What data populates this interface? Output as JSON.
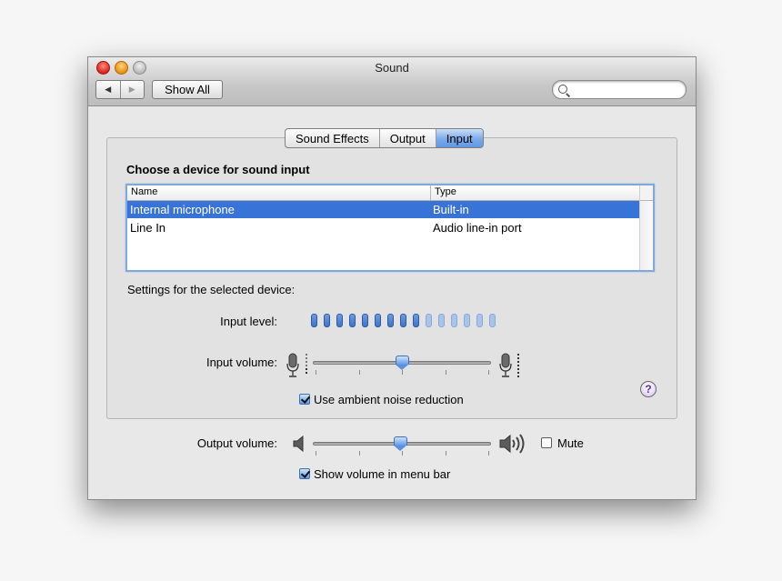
{
  "window": {
    "title": "Sound",
    "nav_back": "◀",
    "nav_forward": "▶",
    "show_all": "Show All",
    "search_placeholder": ""
  },
  "tabs": [
    {
      "label": "Sound Effects",
      "active": false
    },
    {
      "label": "Output",
      "active": false
    },
    {
      "label": "Input",
      "active": true
    }
  ],
  "input": {
    "heading": "Choose a device for sound input",
    "columns": {
      "name": "Name",
      "type": "Type"
    },
    "devices": [
      {
        "name": "Internal microphone",
        "type": "Built-in",
        "selected": true
      },
      {
        "name": "Line In",
        "type": "Audio line-in port",
        "selected": false
      }
    ],
    "settings_label": "Settings for the selected device:",
    "input_level_label": "Input level:",
    "input_level": {
      "active_bars": 9,
      "total_bars": 15
    },
    "input_volume_label": "Input volume:",
    "input_volume": 0.5,
    "ambient_noise_label": "Use ambient noise reduction",
    "ambient_noise_checked": true,
    "help": "?"
  },
  "output": {
    "volume_label": "Output volume:",
    "volume": 0.49,
    "mute_label": "Mute",
    "mute_checked": false,
    "menu_bar_label": "Show volume in menu bar",
    "menu_bar_checked": true
  },
  "colors": {
    "selection": "#3874d7",
    "level_on": "#3f72c9",
    "level_off": "#aac3ea",
    "tab_active": "#79aaea"
  }
}
